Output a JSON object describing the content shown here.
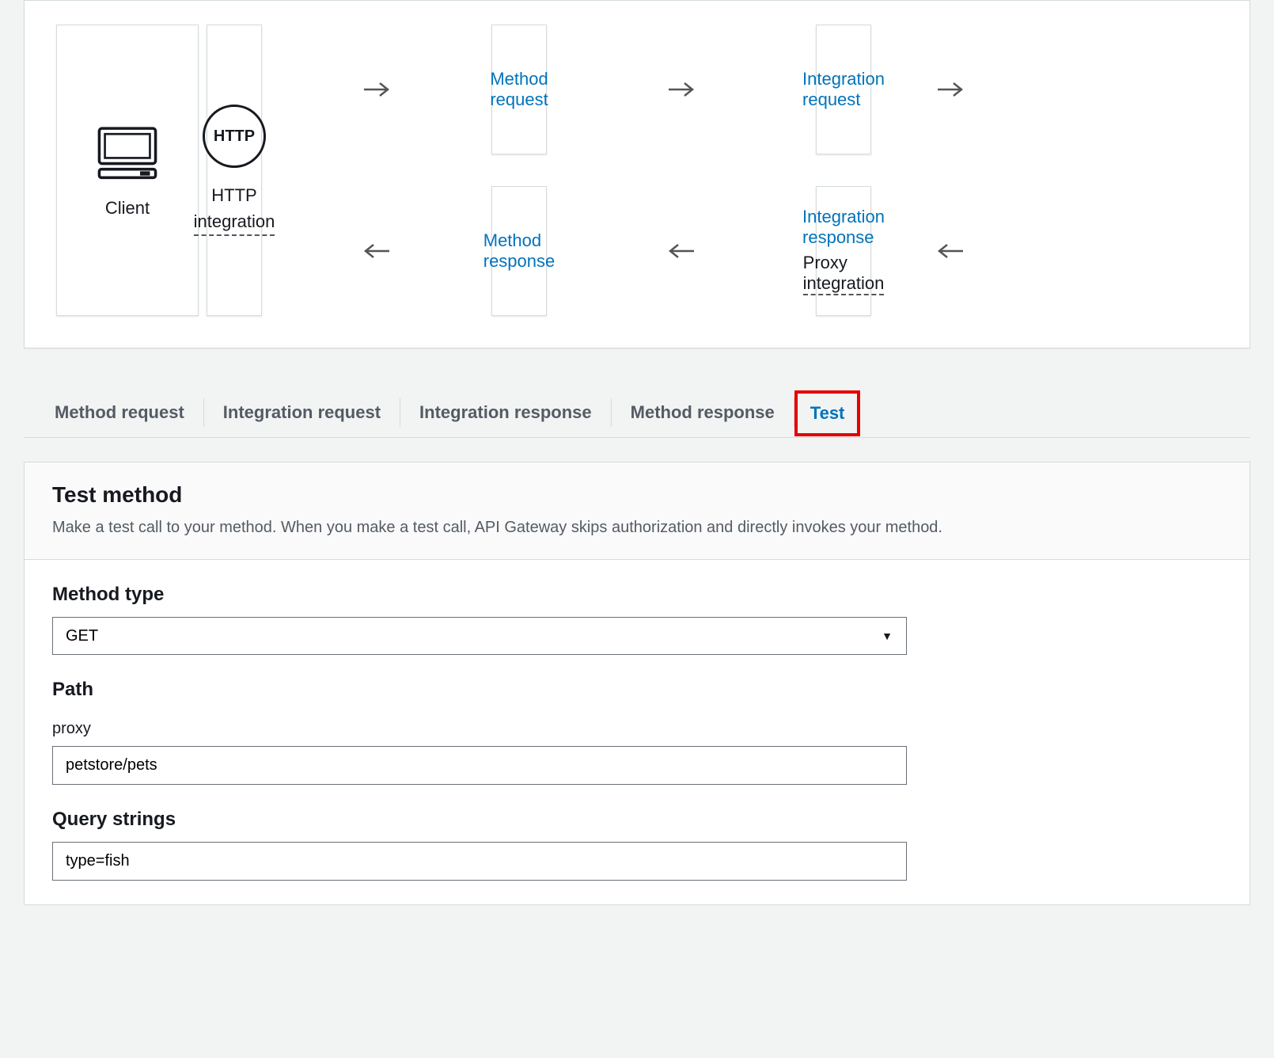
{
  "diagram": {
    "client_label": "Client",
    "method_request": "Method request",
    "integration_request": "Integration request",
    "integration_response": "Integration response",
    "proxy_integration": "Proxy integration",
    "method_response": "Method response",
    "http_circle": "HTTP",
    "http_label": "HTTP integration"
  },
  "tabs": {
    "items": [
      "Method request",
      "Integration request",
      "Integration response",
      "Method response",
      "Test"
    ]
  },
  "panel": {
    "title": "Test method",
    "description": "Make a test call to your method. When you make a test call, API Gateway skips authorization and directly invokes your method."
  },
  "form": {
    "method_type_label": "Method type",
    "method_type_value": "GET",
    "path_label": "Path",
    "proxy_label": "proxy",
    "proxy_value": "petstore/pets",
    "query_strings_label": "Query strings",
    "query_strings_value": "type=fish"
  }
}
